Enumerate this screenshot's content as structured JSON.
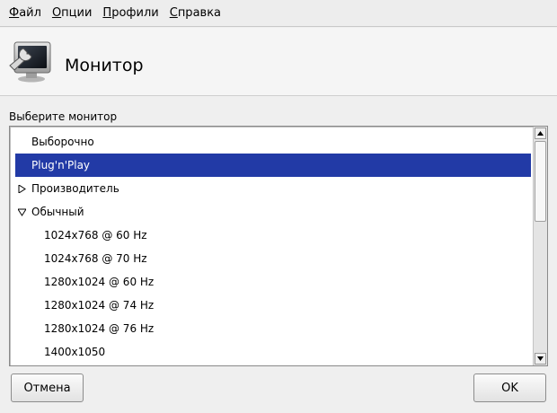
{
  "menubar": {
    "items": [
      {
        "accel": "Ф",
        "rest": "айл"
      },
      {
        "accel": "О",
        "rest": "пции"
      },
      {
        "accel": "П",
        "rest": "рофили"
      },
      {
        "accel": "С",
        "rest": "правка"
      }
    ]
  },
  "header": {
    "title": "Монитор",
    "icon": "monitor-wrench-icon"
  },
  "section_label": "Выберите монитор",
  "list": {
    "rows": [
      {
        "label": "Выборочно"
      },
      {
        "label": "Plug'n'Play",
        "selected": true
      },
      {
        "label": "Производитель",
        "expander": "collapsed"
      },
      {
        "label": "Обычный",
        "expander": "expanded"
      },
      {
        "label": "1024x768 @ 60 Hz"
      },
      {
        "label": "1024x768 @ 70 Hz"
      },
      {
        "label": "1280x1024 @ 60 Hz"
      },
      {
        "label": "1280x1024 @ 74 Hz"
      },
      {
        "label": "1280x1024 @ 76 Hz"
      },
      {
        "label": "1400x1050"
      }
    ]
  },
  "buttons": {
    "cancel": "Отмена",
    "ok": "OK"
  },
  "colors": {
    "selection": "#223aa6",
    "window_bg": "#efefef"
  }
}
